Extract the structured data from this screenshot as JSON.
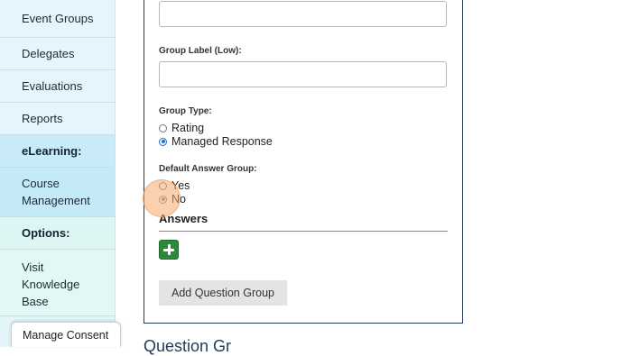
{
  "sidebar": {
    "items": [
      {
        "label": "Event Groups"
      },
      {
        "label": "Delegates"
      },
      {
        "label": "Evaluations"
      },
      {
        "label": "Reports"
      },
      {
        "label": "eLearning:"
      },
      {
        "label": "Course Management"
      },
      {
        "label": "Options:"
      },
      {
        "label": "Visit Knowledge Base"
      }
    ],
    "manage_consent": "Manage Consent"
  },
  "form": {
    "group_label_low": "Group Label (Low):",
    "group_type": {
      "label": "Group Type:",
      "options": [
        "Rating",
        "Managed Response"
      ],
      "selected": "Managed Response"
    },
    "default_answer_group": {
      "label": "Default Answer Group:",
      "options": [
        "Yes",
        "No"
      ],
      "selected": "No"
    },
    "answers_title": "Answers",
    "add_question_group": "Add Question Group"
  },
  "below_heading": "Question Gr"
}
